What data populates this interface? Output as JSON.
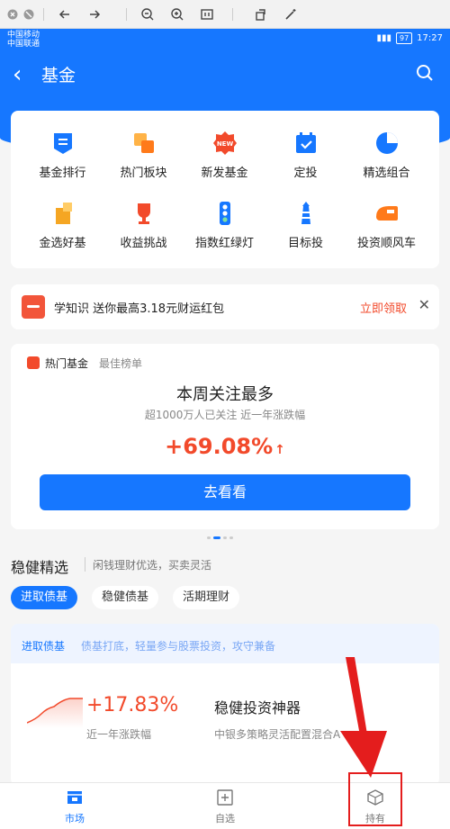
{
  "browser": {
    "icons": [
      "close-icon",
      "stop-icon",
      "back-arrow-icon",
      "forward-arrow-icon",
      "zoom-out-icon",
      "zoom-in-icon",
      "fit-icon",
      "rotate-icon",
      "magic-icon"
    ]
  },
  "status": {
    "carrier1": "中国移动",
    "carrier2": "中国联通",
    "battery": "97",
    "time": "17:27"
  },
  "header": {
    "title": "基金"
  },
  "grid": [
    {
      "label": "基金排行",
      "color": "#1677ff"
    },
    {
      "label": "热门板块",
      "color": "#ff7a1a"
    },
    {
      "label": "新发基金",
      "color": "#f24a2b"
    },
    {
      "label": "定投",
      "color": "#1677ff"
    },
    {
      "label": "精选组合",
      "color": "#1677ff"
    },
    {
      "label": "金选好基",
      "color": "#f5a623"
    },
    {
      "label": "收益挑战",
      "color": "#f24a2b"
    },
    {
      "label": "指数红绿灯",
      "color": "#1677ff"
    },
    {
      "label": "目标投",
      "color": "#1677ff"
    },
    {
      "label": "投资顺风车",
      "color": "#ff7a1a"
    }
  ],
  "new_badge": "NEW",
  "promo": {
    "text": "学知识 送你最高3.18元财运红包",
    "link": "立即领取"
  },
  "hot": {
    "title": "热门基金",
    "subtitle": "最佳榜单",
    "main": "本周关注最多",
    "sub": "超1000万人已关注 近一年涨跌幅",
    "pct": "+69.08%",
    "button": "去看看"
  },
  "steady": {
    "title": "稳健精选",
    "sub": "闲钱理财优选，买卖灵活",
    "chips": [
      "进取债基",
      "稳健债基",
      "活期理财"
    ]
  },
  "fund": {
    "tag": "进取债基",
    "tagline": "债基打底，轻量参与股票投资，攻守兼备",
    "pct": "+17.83%",
    "pct_label": "近一年涨跌幅",
    "name": "稳健投资神器",
    "desc": "中银多策略灵活配置混合A"
  },
  "tabs": [
    "市场",
    "自选",
    "持有"
  ],
  "accent": "#1677ff",
  "red": "#f24a2b"
}
